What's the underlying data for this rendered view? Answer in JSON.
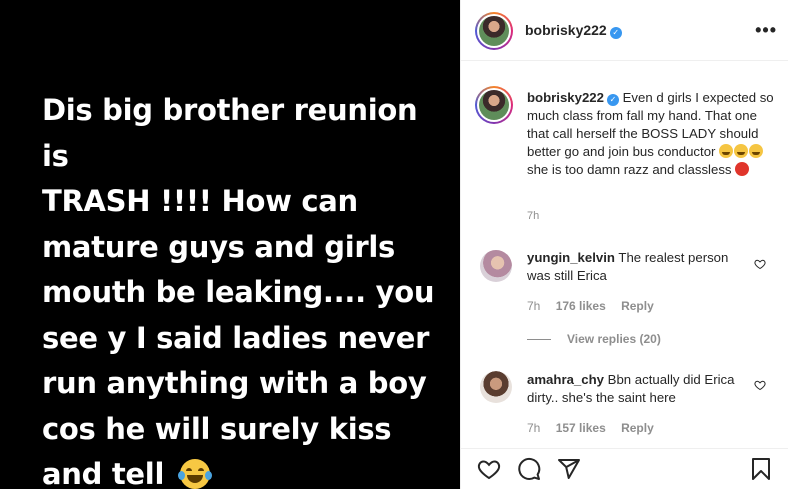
{
  "media": {
    "lines": [
      "Dis big brother reunion is",
      "TRASH !!!! How can",
      "mature guys and girls",
      "mouth be leaking.... you",
      "see y I said ladies never",
      "run anything with a boy",
      "cos he will surely kiss",
      "and tell"
    ],
    "emoji": "laughing-with-tears-emoji"
  },
  "header": {
    "username": "bobrisky222",
    "more_label": "•••"
  },
  "caption": {
    "username": "bobrisky222",
    "text_part1": "Even d girls I expected so much class from fall my hand. That one that call herself the BOSS LADY should better go and join bus conductor",
    "text_part2": "she is too damn razz and classless",
    "time": "7h"
  },
  "comments": [
    {
      "username": "yungin_kelvin",
      "text": "The realest person was still Erica",
      "time": "7h",
      "likes": "176 likes",
      "reply": "Reply"
    },
    {
      "username": "amahra_chy",
      "text": "Bbn actually did Erica dirty.. she's the saint here",
      "time": "7h",
      "likes": "157 likes",
      "reply": "Reply"
    }
  ],
  "view_replies": "View replies (20)",
  "icons": [
    "more-icon",
    "verified-badge-icon",
    "heart-icon",
    "comment-icon",
    "share-icon",
    "bookmark-icon"
  ],
  "colors": {
    "media_bg": "#000000",
    "verified": "#3897f0",
    "muted": "#8e8e8e",
    "border": "#efefef"
  }
}
